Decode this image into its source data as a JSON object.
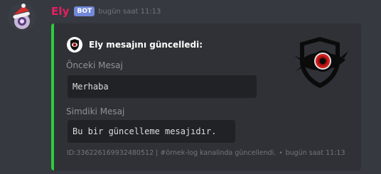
{
  "message": {
    "username": "Ely",
    "bot_tag": "BOT",
    "timestamp": "bugün saat 11:13",
    "username_color": "#e91e63",
    "avatar_icon": "ely-santa-hat-avatar"
  },
  "embed": {
    "accent_color": "#2ecc40",
    "author": {
      "icon": "red-eye-shield-icon",
      "name": "Ely mesajını güncelledi:"
    },
    "thumbnail_icon": "red-eye-shield-logo",
    "fields": [
      {
        "name": "Önceki Mesaj",
        "value": "Merhaba"
      },
      {
        "name": "Simdiki Mesaj",
        "value": "Bu bir güncelleme mesajıdır."
      }
    ],
    "footer": {
      "text": "ID:336226169932480512 | #örnek-log kanalinda güncellendi.",
      "separator": "•",
      "timestamp": "bugün saat 11:13"
    }
  }
}
